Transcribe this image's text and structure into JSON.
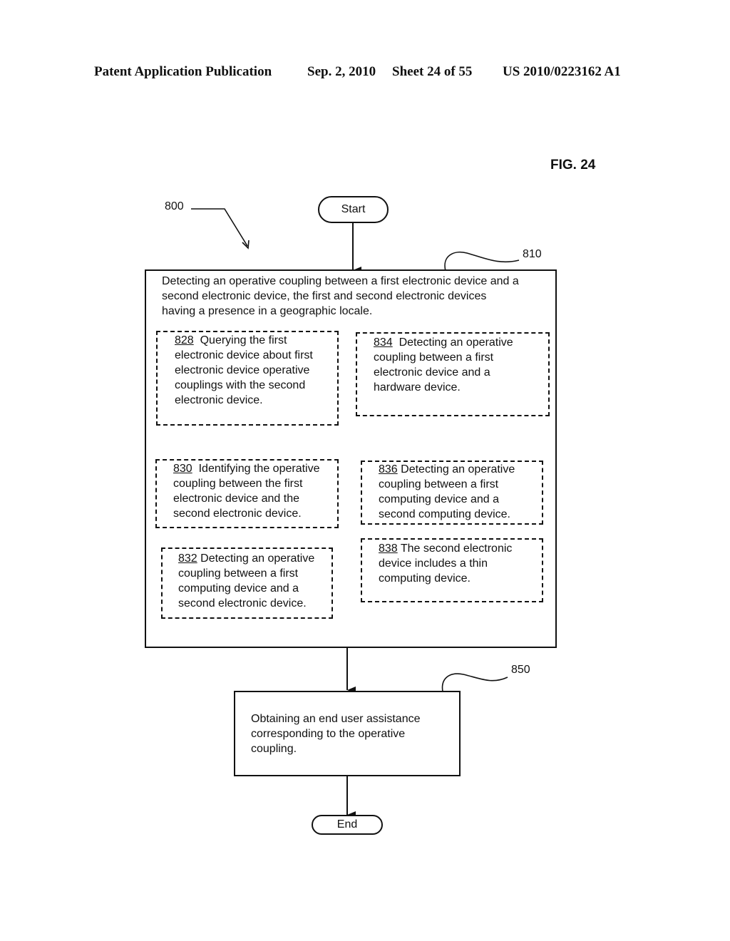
{
  "header": {
    "publication": "Patent Application Publication",
    "date": "Sep. 2, 2010",
    "sheet": "Sheet 24 of 55",
    "number": "US 2010/0223162 A1"
  },
  "figure_label": "FIG. 24",
  "refs": {
    "flow": "800",
    "step_810": "810",
    "step_850": "850"
  },
  "terminals": {
    "start": "Start",
    "end": "End"
  },
  "step_810": {
    "text": "Detecting an operative coupling between a first electronic device and a second electronic device, the first and second electronic devices having a presence in a geographic locale.",
    "lines": [
      "Detecting an operative coupling between a first electronic device and a",
      "second electronic device, the first and second electronic devices",
      "having a presence in a geographic locale."
    ],
    "options": [
      {
        "num": "828",
        "text": "Querying the first electronic device about first electronic device operative couplings with the second electronic device."
      },
      {
        "num": "834",
        "text": "Detecting an operative coupling between a first electronic device and a hardware device."
      },
      {
        "num": "830",
        "text": "Identifying the operative coupling between the first electronic device and the second electronic device."
      },
      {
        "num": "836",
        "text": "Detecting an operative coupling between a first computing device and a second computing device."
      },
      {
        "num": "832",
        "text": "Detecting an operative coupling between a first computing device and a second electronic device."
      },
      {
        "num": "838",
        "text": "The second electronic device includes a thin computing device."
      }
    ]
  },
  "step_850": {
    "text": "Obtaining an end user assistance corresponding to the operative coupling."
  }
}
